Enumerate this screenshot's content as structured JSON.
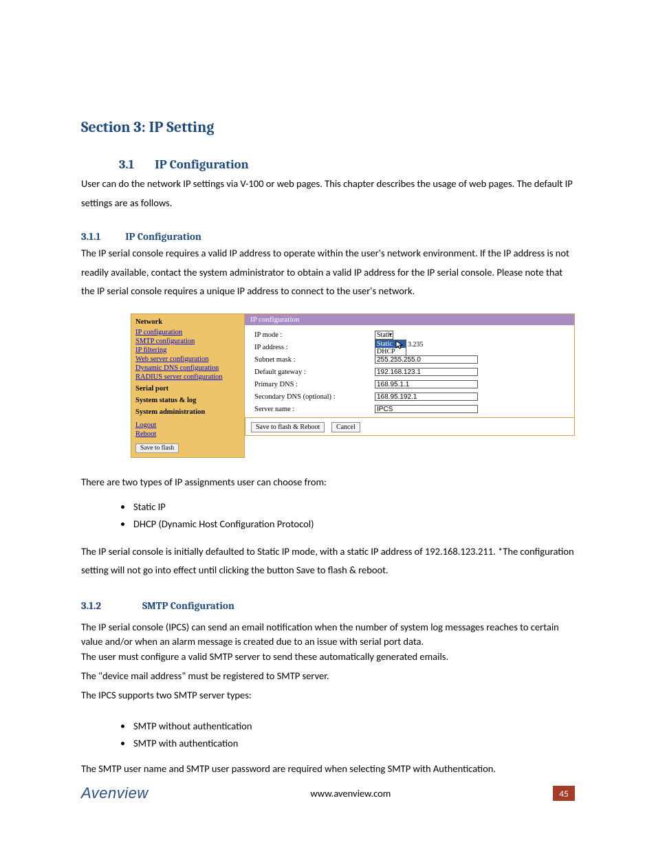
{
  "headings": {
    "h1": "Section 3: IP Setting",
    "h2_num": "3.1",
    "h2_txt": "IP Configuration",
    "h3a_num": "3.1.1",
    "h3a_txt": "IP Configuration",
    "h3b_num": "3.1.2",
    "h3b_txt": "SMTP Configuration"
  },
  "paras": {
    "p1": "User can do the network IP settings via V-100 or web pages. This chapter describes the usage of web pages. The default IP settings are as follows.",
    "p2": "The IP serial console requires a valid IP address to operate within the user's network environment. If the IP address is not readily available, contact the system administrator to obtain a valid IP address for the IP serial console. Please note that the IP serial console requires a unique IP address to connect to the user's network.",
    "p3": "There are two types of IP assignments user can choose from:",
    "p4": "The IP serial console is initially defaulted to Static IP mode, with a static IP address of 192.168.123.211. *The configuration setting will not go into effect until clicking the button Save to flash & reboot.",
    "p5a": "The IP serial console (IPCS) can send an email notification when the number of system log messages reaches to certain value and/or when an alarm message is created due to an issue with serial port data.",
    "p5b": "The user must configure a valid SMTP server to send these automatically generated emails.",
    "p6": "The \"device mail address\" must be registered to SMTP server.",
    "p7": "The IPCS supports two SMTP server types:",
    "p8": "The SMTP user name and SMTP user password are required when selecting SMTP with Authentication."
  },
  "list1": [
    "Static IP",
    "DHCP (Dynamic Host Configuration Protocol)"
  ],
  "list2": [
    "SMTP without authentication",
    "SMTP with authentication"
  ],
  "screenshot": {
    "sidebar": {
      "head": "Network",
      "links": [
        "IP configuration",
        "SMTP configuration",
        "IP filtering",
        "Web server configuration",
        "Dynamic DNS configuration",
        "RADIUS server configuration"
      ],
      "sections": [
        "Serial port",
        "System status & log",
        "System administration"
      ],
      "bottom_links": [
        "Logout",
        "Reboot"
      ],
      "button": "Save to flash"
    },
    "main": {
      "title": "IP configuration",
      "rows": [
        {
          "label": "IP mode :"
        },
        {
          "label": "IP address :"
        },
        {
          "label": "Subnet mask :"
        },
        {
          "label": "Default gateway :"
        },
        {
          "label": "Primary DNS :"
        },
        {
          "label": "Secondary DNS (optional) :"
        },
        {
          "label": "Server name :"
        }
      ],
      "select_value": "Static",
      "select_options": [
        "Static",
        "DHCP"
      ],
      "ip_tail": "3.235",
      "subnet": "255.255.255.0",
      "gateway": "192.168.123.1",
      "dns1": "168.95.1.1",
      "dns2": "168.95.192.1",
      "server": "IPCS",
      "buttons": [
        "Save to flash & Reboot",
        "Cancel"
      ]
    }
  },
  "footer": {
    "logo": "Avenview",
    "url": "www.avenview.com",
    "page": "45"
  }
}
